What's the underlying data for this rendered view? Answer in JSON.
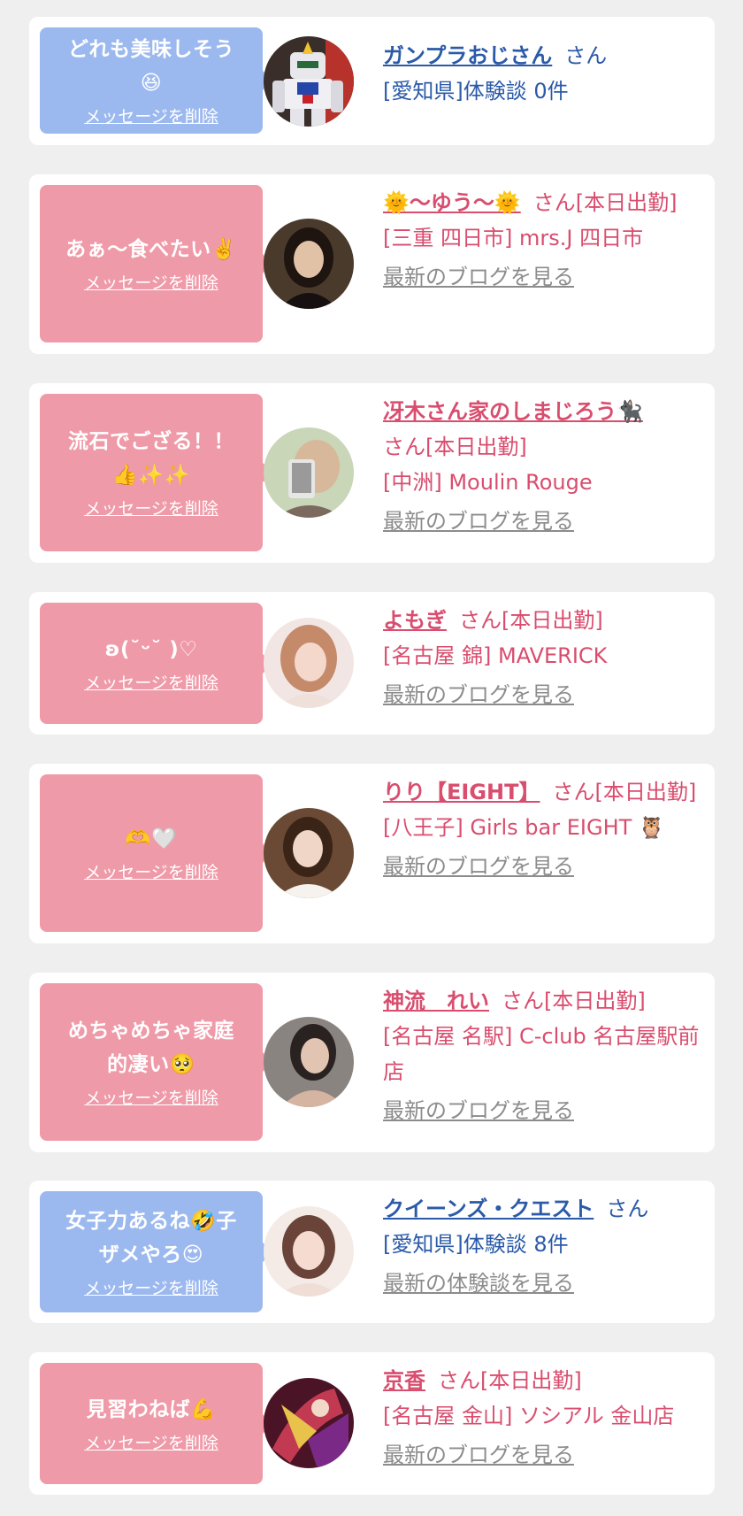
{
  "cards": [
    {
      "theme": "blue",
      "message": "どれも美味しそう\n😆",
      "delete_label": "メッセージを削除",
      "name": "ガンプラおじさん",
      "suffix": "さん",
      "detail": "[愛知県]体験談 0件",
      "link": "",
      "avatar": "robot-figure"
    },
    {
      "theme": "pink",
      "message": "あぁ〜食べたい✌️",
      "delete_label": "メッセージを削除",
      "name": "🌞〜ゆう〜🌞",
      "suffix": "さん[本日出勤]",
      "detail": "[三重 四日市] mrs.J 四日市",
      "link": "最新のブログを見る",
      "avatar": "woman-dark"
    },
    {
      "theme": "pink",
      "message": "流石でござる！！\n👍✨✨",
      "delete_label": "メッセージを削除",
      "name": "冴木さん家のしまじろう🐈‍⬛",
      "suffix": "さん[本日出勤]",
      "detail": "[中洲] Moulin Rouge",
      "link": "最新のブログを見る",
      "avatar": "selfie-green"
    },
    {
      "theme": "pink",
      "message": "ʚ(˘ᵕ˘ )♡",
      "delete_label": "メッセージを削除",
      "name": "よもぎ",
      "suffix": "さん[本日出勤]",
      "detail": "[名古屋 錦] MAVERICK",
      "link": "最新のブログを見る",
      "avatar": "woman-light"
    },
    {
      "theme": "pink",
      "message": "🫶🤍",
      "delete_label": "メッセージを削除",
      "name": "りり【EIGHT】",
      "suffix": "さん[本日出勤]",
      "detail": "[八王子] Girls bar EIGHT 🦉",
      "link": "最新のブログを見る",
      "avatar": "woman-brown"
    },
    {
      "theme": "pink",
      "message": "めちゃめちゃ家庭\n的凄い🥺",
      "delete_label": "メッセージを削除",
      "name": "神流　れい",
      "suffix": "さん[本日出勤]",
      "detail": "[名古屋 名駅] C-club 名古屋駅前店",
      "link": "最新のブログを見る",
      "avatar": "woman-grey"
    },
    {
      "theme": "blue",
      "message": "女子力あるね🤣子\nザメやろ😍",
      "delete_label": "メッセージを削除",
      "name": "クイーンズ・クエスト",
      "suffix": "さん",
      "detail": "[愛知県]体験談 8件",
      "link": "最新の体験談を見る",
      "avatar": "illustrated-woman"
    },
    {
      "theme": "pink",
      "message": "見習わねば💪",
      "delete_label": "メッセージを削除",
      "name": "京香",
      "suffix": "さん[本日出勤]",
      "detail": "[名古屋 金山] ソシアル 金山店",
      "link": "最新のブログを見る",
      "avatar": "kimono-fan"
    }
  ]
}
